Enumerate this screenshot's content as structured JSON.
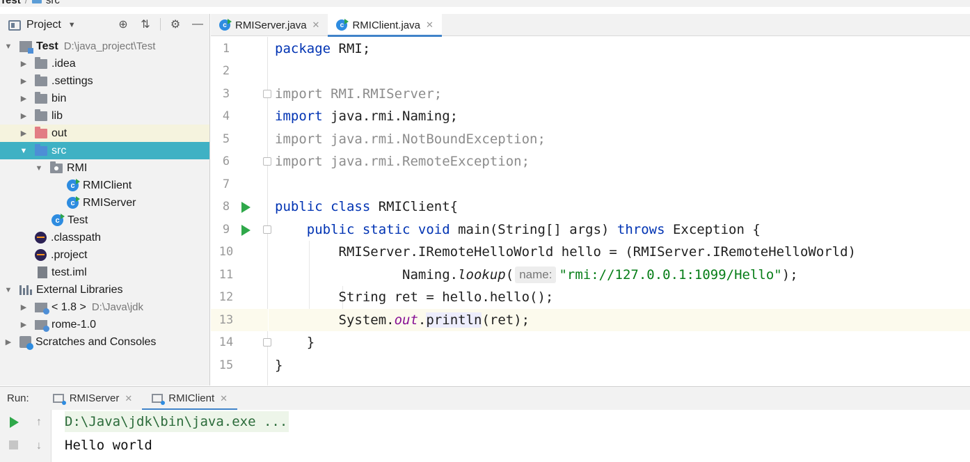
{
  "breadcrumb": {
    "project": "Test",
    "folder": "src"
  },
  "project_panel": {
    "title": "Project",
    "tree": [
      {
        "label": "Test",
        "path": "D:\\java_project\\Test"
      },
      {
        "label": ".idea"
      },
      {
        "label": ".settings"
      },
      {
        "label": "bin"
      },
      {
        "label": "lib"
      },
      {
        "label": "out"
      },
      {
        "label": "src"
      },
      {
        "label": "RMI"
      },
      {
        "label": "RMIClient"
      },
      {
        "label": "RMIServer"
      },
      {
        "label": "Test"
      },
      {
        "label": ".classpath"
      },
      {
        "label": ".project"
      },
      {
        "label": "test.iml"
      },
      {
        "label": "External Libraries"
      },
      {
        "label": "< 1.8 >",
        "path": "D:\\Java\\jdk"
      },
      {
        "label": "rome-1.0"
      },
      {
        "label": "Scratches and Consoles"
      }
    ]
  },
  "editor": {
    "tabs": [
      {
        "label": "RMIServer.java",
        "active": false
      },
      {
        "label": "RMIClient.java",
        "active": true
      }
    ],
    "line_numbers": [
      "1",
      "2",
      "3",
      "4",
      "5",
      "6",
      "7",
      "8",
      "9",
      "10",
      "11",
      "12",
      "13",
      "14",
      "15"
    ],
    "current_line": 13,
    "code": {
      "l1_kw": "package",
      "l1_rest": " RMI;",
      "l3": "import RMI.RMIServer;",
      "l4_kw": "import",
      "l4_rest": " java.rmi.Naming;",
      "l5": "import java.rmi.NotBoundException;",
      "l6": "import java.rmi.RemoteException;",
      "l8_kw": "public class",
      "l8_rest": " RMIClient{",
      "l9_indent": "    ",
      "l9_kw1": "public static void",
      "l9_mid": " main(String[] args) ",
      "l9_kw2": "throws",
      "l9_rest": " Exception {",
      "l10": "        RMIServer.IRemoteHelloWorld hello = (RMIServer.IRemoteHelloWorld)",
      "l11_pre": "                Naming.",
      "l11_method": "lookup",
      "l11_paren": "(",
      "l11_hint": "name:",
      "l11_str": "\"rmi://127.0.0.1:1099/Hello\"",
      "l11_end": ");",
      "l12": "        String ret = hello.hello();",
      "l13_pre": "        System.",
      "l13_static": "out",
      "l13_dot": ".",
      "l13_method": "println",
      "l13_end": "(ret);",
      "l14": "    }",
      "l15": "}"
    }
  },
  "run_panel": {
    "label": "Run:",
    "tabs": [
      {
        "label": "RMIServer",
        "active": false
      },
      {
        "label": "RMIClient",
        "active": true
      }
    ],
    "console": {
      "command": "D:\\Java\\jdk\\bin\\java.exe ...",
      "output": "Hello world"
    }
  },
  "colors": {
    "selection": "#3fb1c4",
    "keyword": "#0033b3",
    "string": "#067d17",
    "static_field": "#871094",
    "run_green": "#2fa84a",
    "tab_underline": "#4083c9"
  }
}
